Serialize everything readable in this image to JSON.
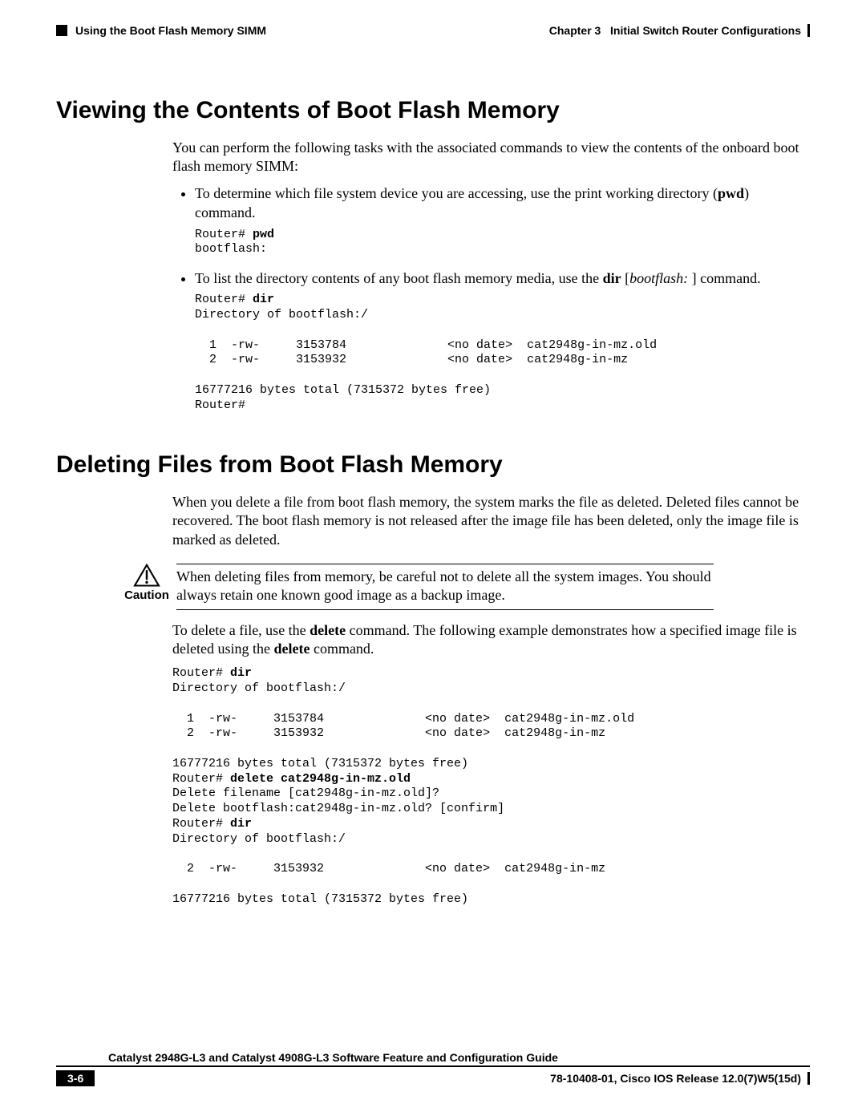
{
  "header": {
    "section_title": "Using the Boot Flash Memory SIMM",
    "chapter_label": "Chapter 3",
    "chapter_name": "Initial Switch Router Configurations"
  },
  "section1": {
    "title": "Viewing the Contents of Boot Flash Memory",
    "intro": "You can perform the following tasks with the associated commands to view the contents of the onboard boot flash memory SIMM:",
    "bullet1_pre": "To determine which file system device you are accessing, use the print working directory (",
    "bullet1_cmd": "pwd",
    "bullet1_post": ") command.",
    "code1_prompt": "Router# ",
    "code1_cmd": "pwd",
    "code1_out": "bootflash:",
    "bullet2_pre": "To list the directory contents of any boot flash memory media, use the ",
    "bullet2_cmd": "dir",
    "bullet2_mid": " [",
    "bullet2_arg": "bootflash: ",
    "bullet2_post": "] command.",
    "code2_prompt": "Router# ",
    "code2_cmd": "dir",
    "code2_l1": "Directory of bootflash:/",
    "code2_l2": "  1  -rw-     3153784              <no date>  cat2948g-in-mz.old",
    "code2_l3": "  2  -rw-     3153932              <no date>  cat2948g-in-mz",
    "code2_l4": "16777216 bytes total (7315372 bytes free)",
    "code2_l5": "Router#"
  },
  "section2": {
    "title": "Deleting Files from Boot Flash Memory",
    "para1": "When you delete a file from boot flash memory, the system marks the file as deleted. Deleted files cannot be recovered. The boot flash memory is not released after the image file has been deleted, only the image file is marked as deleted.",
    "caution_label": "Caution",
    "caution_text": "When deleting files from memory, be careful not to delete all the system images. You should always retain one known good image as a backup image.",
    "para2_pre": "To delete a file, use the ",
    "para2_cmd1": "delete",
    "para2_mid": " command. The following example demonstrates how a specified image file is deleted using the ",
    "para2_cmd2": "delete",
    "para2_post": " command.",
    "code3_p1": "Router# ",
    "code3_c1": "dir",
    "code3_l1": "Directory of bootflash:/",
    "code3_l2": "  1  -rw-     3153784              <no date>  cat2948g-in-mz.old",
    "code3_l3": "  2  -rw-     3153932              <no date>  cat2948g-in-mz",
    "code3_l4": "16777216 bytes total (7315372 bytes free)",
    "code3_p2": "Router# ",
    "code3_c2": "delete cat2948g-in-mz.old",
    "code3_l5": "Delete filename [cat2948g-in-mz.old]?",
    "code3_l6": "Delete bootflash:cat2948g-in-mz.old? [confirm]",
    "code3_p3": "Router# ",
    "code3_c3": "dir",
    "code3_l7": "Directory of bootflash:/",
    "code3_l8": "  2  -rw-     3153932              <no date>  cat2948g-in-mz",
    "code3_l9": "16777216 bytes total (7315372 bytes free)"
  },
  "footer": {
    "title": "Catalyst 2948G-L3 and Catalyst 4908G-L3 Software Feature and Configuration Guide",
    "page_num": "3-6",
    "doc_id": "78-10408-01, Cisco IOS Release 12.0(7)W5(15d)"
  }
}
